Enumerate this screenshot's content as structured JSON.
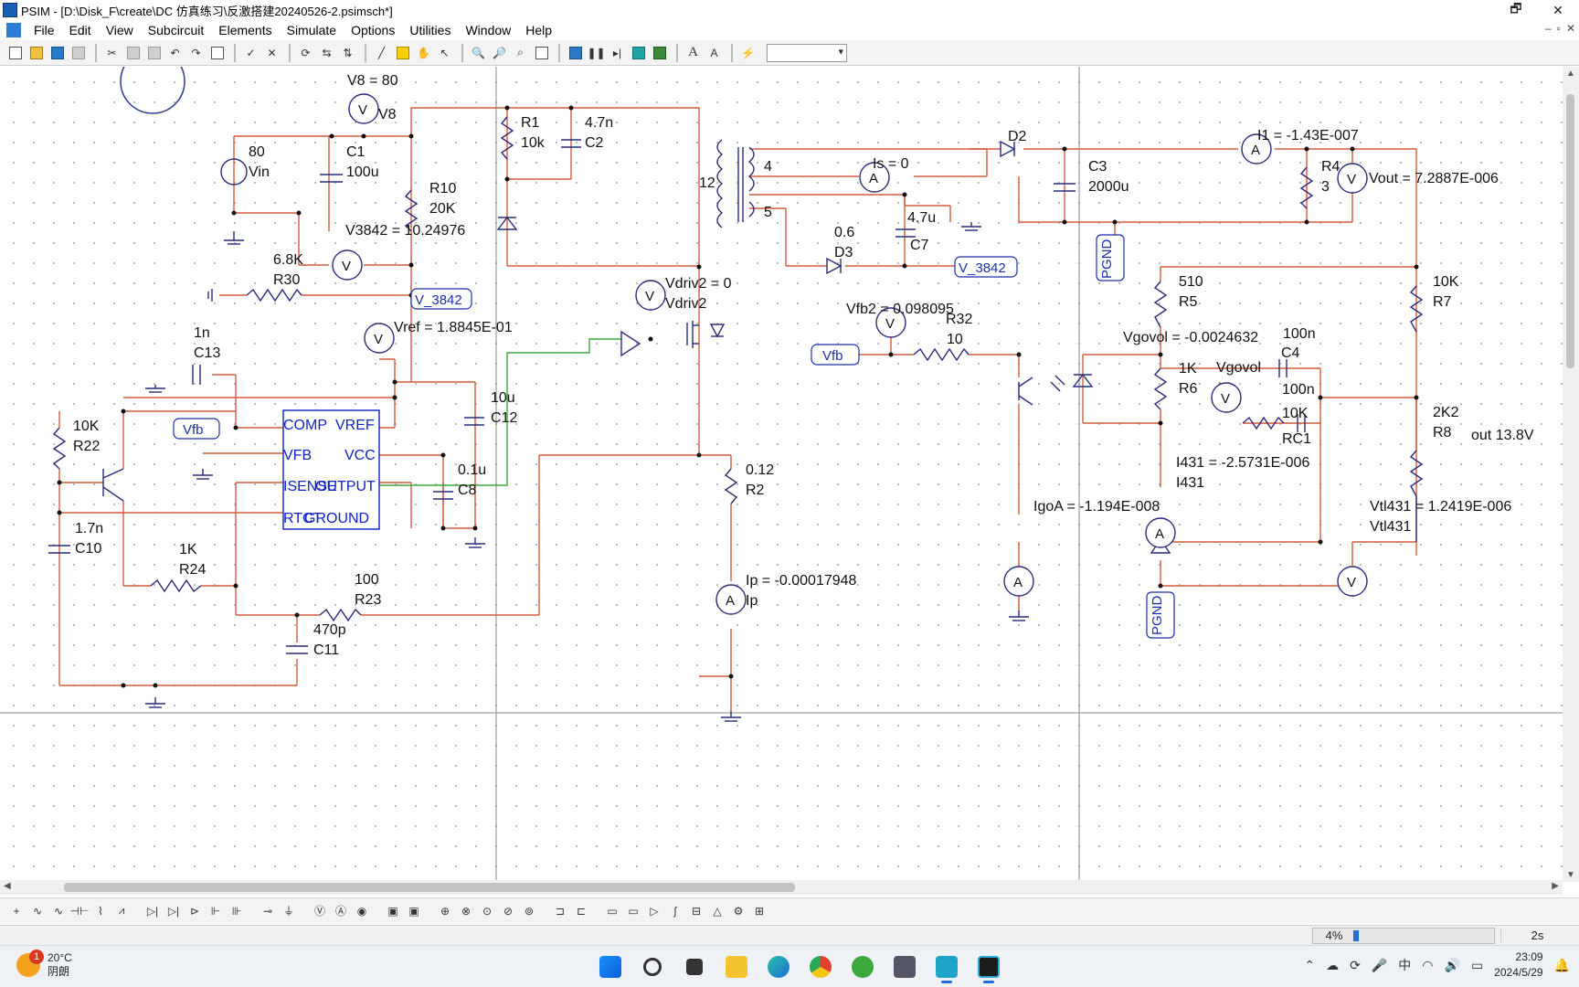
{
  "window": {
    "title": "PSIM - [D:\\Disk_F\\create\\DC 仿真练习\\反激搭建20240526-2.psimsch*]",
    "controls": [
      "🗗",
      "✕"
    ]
  },
  "menu": [
    "File",
    "Edit",
    "View",
    "Subcircuit",
    "Elements",
    "Simulate",
    "Options",
    "Utilities",
    "Window",
    "Help"
  ],
  "mdi_controls": [
    "–",
    "▫",
    "✕"
  ],
  "schematic": {
    "labels": {
      "v8_value": "V8 = 80",
      "v8_name": "V8",
      "vin_value": "80",
      "vin_name": "Vin",
      "c1_name": "C1",
      "c1_value": "100u",
      "r10_name": "R10",
      "r10_value": "20K",
      "v3842": "V3842 = 10.24976",
      "r1_name": "R1",
      "r1_value": "10k",
      "c2_value": "4.7n",
      "c2_name": "C2",
      "t_primary": "12",
      "t_sec1": "4",
      "t_sec2": "5",
      "is_value": "Is = 0",
      "d2_name": "D2",
      "i1_value": "I1 = -1.43E-007",
      "c3_name": "C3",
      "c3_value": "2000u",
      "r4_name": "R4",
      "r4_value": "3",
      "vout_value": "Vout = 7.2887E-006",
      "c7_value": "4.7u",
      "c7_name": "C7",
      "d3_value": "0.6",
      "d3_name": "D3",
      "r30_value": "6.8K",
      "r30_name": "R30",
      "vref_value": "Vref = 1.8845E-01",
      "vdriv2_value": "Vdriv2 = 0",
      "vdriv2_name": "Vdriv2",
      "vfb2_value": "Vfb2 = 0.098095",
      "r32_name": "R32",
      "r32_value": "10",
      "r5_value": "510",
      "r5_name": "R5",
      "r7_value": "10K",
      "r7_name": "R7",
      "vgovol_value": "Vgovol = -0.0024632",
      "c4_value_top": "100n",
      "c4_name": "C4",
      "r6_value": "1K",
      "r6_name": "R6",
      "vgovol_name": "Vgovol",
      "c4_value": "100n",
      "rc1_value": "10K",
      "rc1_name": "RC1",
      "r8_value": "2K2",
      "r8_name": "R8",
      "out_note": "out 13.8V",
      "c13_value": "1n",
      "c13_name": "C13",
      "c12_value": "10u",
      "c12_name": "C12",
      "r22_value": "10K",
      "r22_name": "R22",
      "c8_value": "0.1u",
      "c8_name": "C8",
      "r2_value": "0.12",
      "r2_name": "R2",
      "i431_value": "I431 = -2.5731E-006",
      "i431_name": "I431",
      "igoa_value": "IgoA = -1.194E-008",
      "vtl431_value": "Vtl431 = 1.2419E-006",
      "vtl431_name": "Vtl431",
      "c10_value": "1.7n",
      "c10_name": "C10",
      "r24_value": "1K",
      "r24_name": "R24",
      "r23_value": "100",
      "r23_name": "R23",
      "c11_value": "470p",
      "c11_name": "C11",
      "ip_value": "Ip = -0.00017948",
      "ip_name": "Ip"
    },
    "ic": {
      "comp": "COMP",
      "vref": "VREF",
      "vfb": "VFB",
      "vcc": "VCC",
      "isense": "ISENSE",
      "output": "OUTPUT",
      "rtct": "RTCT",
      "ground": "GROUND"
    },
    "tags": {
      "v3842_a": "V_3842",
      "v3842_b": "V_3842",
      "vfb_a": "Vfb",
      "vfb_b": "Vfb",
      "pgnd_a": "PGND",
      "pgnd_b": "PGND"
    },
    "meter_glyphs": {
      "voltmeter": "V",
      "ammeter": "A"
    }
  },
  "status": {
    "progress_label": "4%",
    "progress_fraction": 0.04,
    "sim_time": "2s"
  },
  "taskbar": {
    "weather_temp": "20°C",
    "weather_desc": "阴朗",
    "weather_badge": "1",
    "ime": "中",
    "time": "23:09",
    "date": "2024/5/29"
  },
  "colors": {
    "wire": "#d65a3c",
    "wire_control": "#3aa83a",
    "component": "#2a2a7a",
    "ic_text": "#1020c8",
    "accent": "#1a6fd8"
  }
}
